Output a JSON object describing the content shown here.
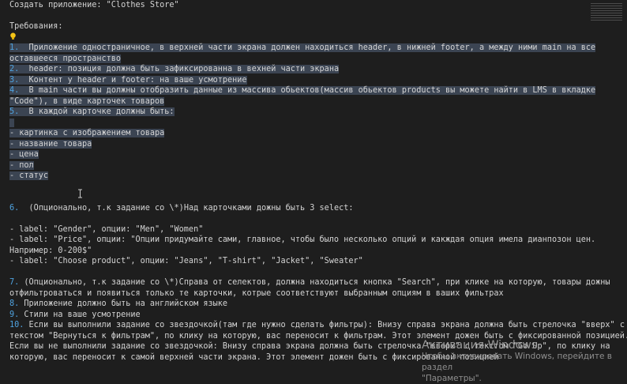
{
  "lines": [
    {
      "text": "Создать приложение: \"Clothes Store\"",
      "sel": false
    },
    {
      "text": "",
      "sel": false
    },
    {
      "text": "Требования:",
      "sel": false
    },
    {
      "text": "",
      "sel": false,
      "icon": "lightbulb-icon"
    },
    {
      "num": "1.",
      "text": "  Приложение одностраничное, в верхней части экрана должен находиться header, в нижней footer, а между ними main на все",
      "sel": true
    },
    {
      "text": "оставшееся пространство",
      "sel": true
    },
    {
      "num": "2.",
      "text": "  header: позиция должна быть зафиксированна в вехней части экрана",
      "sel": true
    },
    {
      "num": "3.",
      "text": "  Контент у header и footer: на ваше усмотрение",
      "sel": true
    },
    {
      "num": "4.",
      "text": "  В main части вы должны отобразить данные из массива обьектов(массив обьектов products вы можете найти в LMS в вкладке",
      "sel": true
    },
    {
      "text": "\"Code\"), в виде карточек товаров",
      "sel": true
    },
    {
      "num": "5.",
      "text": "  В каждой карточке должны быть:",
      "sel": true
    },
    {
      "text": " ",
      "sel": true
    },
    {
      "text": "- картинка с изображением товара",
      "sel": true
    },
    {
      "text": "- название товара",
      "sel": true
    },
    {
      "text": "- цена",
      "sel": true
    },
    {
      "text": "- пол",
      "sel": true
    },
    {
      "text": "- статус",
      "sel": true
    },
    {
      "text": "",
      "sel": false
    },
    {
      "text": "",
      "sel": false
    },
    {
      "num": "6.",
      "text": "  (Опционально, т.к задание со \\*)Над карточками дожны быть 3 select:",
      "sel": false
    },
    {
      "text": "",
      "sel": false
    },
    {
      "text": "- label: \"Gender\", опции: \"Men\", \"Women\"",
      "sel": false
    },
    {
      "text": "- label: \"Price\", опции: \"Опции придумайте сами, главное, чтобы было несколько опций и какждая опция имела дианпозон цен.",
      "sel": false
    },
    {
      "text": "Например: 0-200$\"",
      "sel": false
    },
    {
      "text": "- label: \"Choose product\", опции: \"Jeans\", \"T-shirt\", \"Jacket\", \"Sweater\"",
      "sel": false
    },
    {
      "text": "",
      "sel": false
    },
    {
      "num": "7.",
      "text": " (Опционально, т.к задание со \\*)Справа от селектов, должна находиться кнопка \"Search\", при клике на которую, товары дожны",
      "sel": false
    },
    {
      "text": "отфильтроваться и появиться только те карточки, котрые соответствуют выбранным опциям в ваших фильтрах",
      "sel": false
    },
    {
      "num": "8.",
      "text": " Приложение должно быть на английском языке",
      "sel": false
    },
    {
      "num": "9.",
      "text": " Стили на ваше усмотрение",
      "sel": false
    },
    {
      "num": "10.",
      "text": " Если вы выполнили задание со звездочкой(там где нужно сделать фильтры): Внизу справа экрана должна быть стрелочка \"вверх\" с",
      "sel": false
    },
    {
      "text": "текстом \"Вернуться к фильтрам\", по клику на которую, вас переносит к фильтрам. Этот элемент дожен быть с фиксированной позицией.",
      "sel": false
    },
    {
      "text": "Если вы не выполнили задание со звездочкой: Внизу справа экрана должна быть стрелочка \"вверх\" с текстом \"Go Up\", по клику на",
      "sel": false
    },
    {
      "text": "которую, вас переносит к самой верхней части экрана. Этот элемент дожен быть с фиксированной позицией",
      "sel": false
    }
  ],
  "watermark": {
    "title": "Активация Windows",
    "line1": "Чтобы активировать Windows, перейдите в раздел",
    "line2": "\"Параметры\"."
  },
  "colors": {
    "background": "#1e1e1e",
    "text": "#d4d4d4",
    "list_number": "#4fa3e0",
    "selection": "#3b4452",
    "bulb": "#f5c518"
  }
}
